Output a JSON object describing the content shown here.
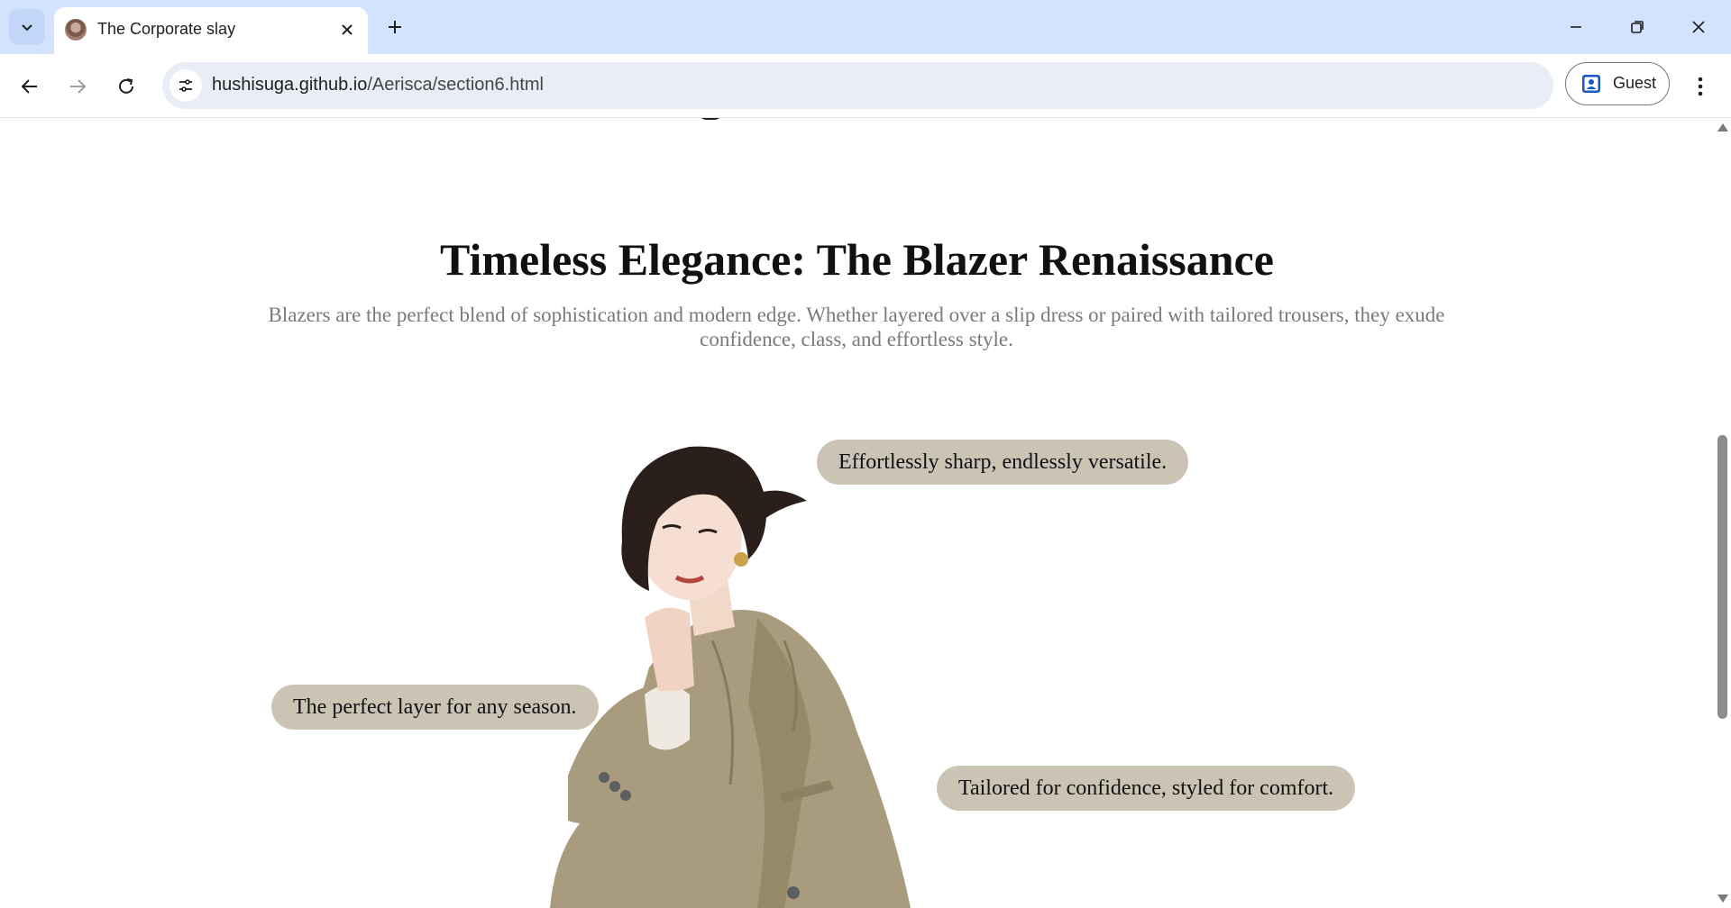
{
  "browser": {
    "tab_title": "The Corporate slay",
    "url_host": "hushisuga.github.io",
    "url_path": "/Aerisca/section6.html",
    "profile_label": "Guest",
    "icons": {
      "tab_search": "chevron-down-icon",
      "tab_close": "close-icon",
      "new_tab": "plus-icon",
      "minimize": "minimize-icon",
      "restore": "restore-icon",
      "close": "close-icon",
      "back": "arrow-left-icon",
      "forward": "arrow-right-icon",
      "reload": "reload-icon",
      "site_info": "tune-icon",
      "profile": "person-icon",
      "menu": "kebab-menu-icon"
    }
  },
  "page": {
    "title": "Timeless Elegance: The Blazer Renaissance",
    "description": "Blazers are the perfect blend of sophistication and modern edge. Whether layered over a slip dress or paired with tailored trousers, they exude confidence, class, and effortless style.",
    "captions": [
      "Effortlessly sharp, endlessly versatile.",
      "The perfect layer for any season.",
      "Tailored for confidence, styled for comfort."
    ],
    "colors": {
      "caption_bg": "#cbc4b4",
      "blazer": "#a99c7e",
      "hair": "#2a1f1b",
      "tabbar_bg": "#d3e3fd"
    }
  }
}
